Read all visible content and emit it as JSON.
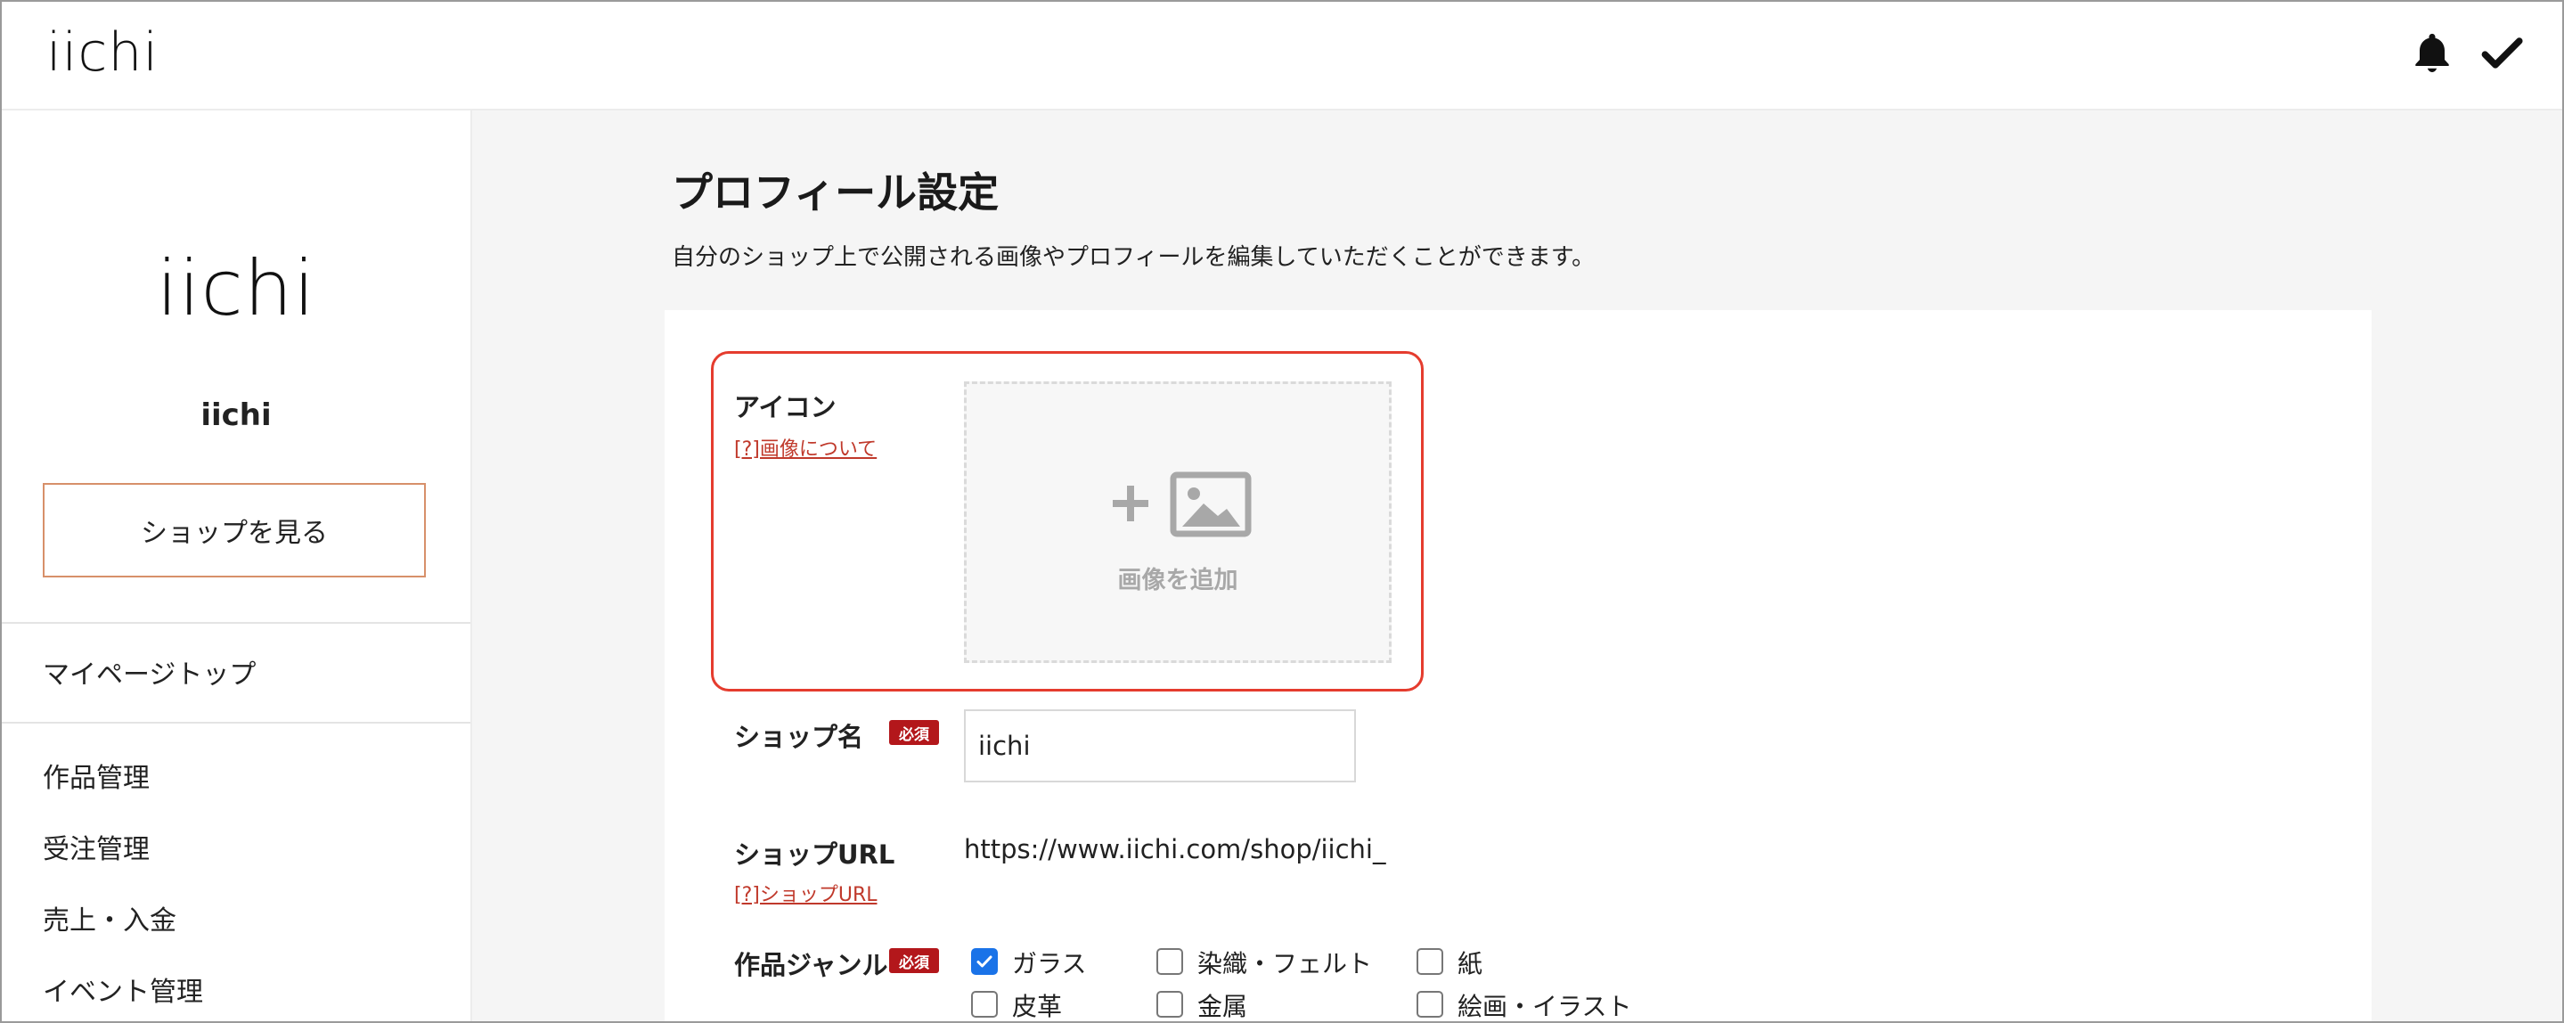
{
  "header": {
    "logo": "iichi",
    "icons": [
      "bell-icon",
      "check-icon"
    ]
  },
  "sidebar": {
    "logo": "iichi",
    "shop_name": "iichi",
    "view_shop_button": "ショップを見る",
    "top_item": "マイページトップ",
    "items": [
      "作品管理",
      "受注管理",
      "売上・入金",
      "イベント管理"
    ]
  },
  "main": {
    "title": "プロフィール設定",
    "description": "自分のショップ上で公開される画像やプロフィールを編集していただくことができます。",
    "icon_field": {
      "label": "アイコン",
      "help_link": "[?]画像について",
      "upload_text": "画像を追加",
      "upload_icons": [
        "plus-icon",
        "image-icon"
      ]
    },
    "shop_name_field": {
      "label": "ショップ名",
      "required_badge": "必須",
      "value": "iichi"
    },
    "shop_url_field": {
      "label": "ショップURL",
      "help_link": "[?]ショップURL",
      "value": "https://www.iichi.com/shop/iichi_"
    },
    "genre_field": {
      "label": "作品ジャンル",
      "required_badge": "必須",
      "options": [
        {
          "label": "ガラス",
          "checked": true
        },
        {
          "label": "染織・フェルト",
          "checked": false
        },
        {
          "label": "紙",
          "checked": false
        },
        {
          "label": "皮革",
          "checked": false
        },
        {
          "label": "金属",
          "checked": false
        },
        {
          "label": "絵画・イラスト",
          "checked": false
        }
      ]
    }
  },
  "colors": {
    "highlight_border": "#e53c2e",
    "required_badge": "#b3171b",
    "link": "#c0392b",
    "checkbox_checked": "#1a73e8",
    "shop_button_border": "#d7906a"
  }
}
